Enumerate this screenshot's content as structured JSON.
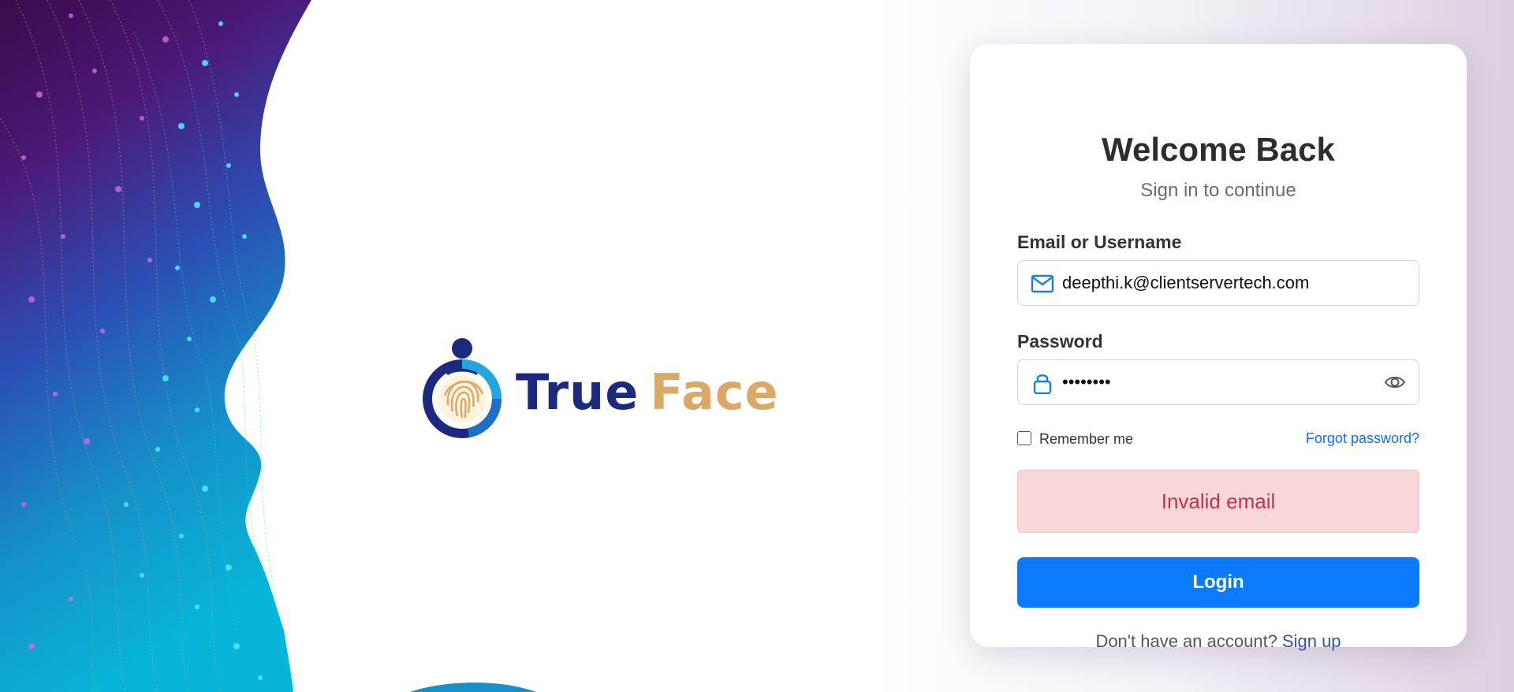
{
  "brand": {
    "name_part1": "True",
    "name_part2": "Face",
    "color_primary": "#1b2a7e",
    "color_accent": "#dba865"
  },
  "login": {
    "title": "Welcome Back",
    "subtitle": "Sign in to continue",
    "email_label": "Email or Username",
    "email_value": "deepthi.k@clientservertech.com",
    "email_icon": "mail-icon",
    "password_label": "Password",
    "password_value": "••••••••",
    "password_icon": "lock-icon",
    "toggle_visibility_icon": "eye-icon",
    "remember_label": "Remember me",
    "remember_checked": false,
    "forgot_label": "Forgot password?",
    "error_message": "Invalid email",
    "login_button": "Login",
    "signup_prompt": "Don't have an account?",
    "signup_link": "Sign up"
  },
  "colors": {
    "primary_button": "#0a7bff",
    "link": "#0d6efd",
    "error_bg": "#f8d7da",
    "error_text": "#c43443"
  }
}
